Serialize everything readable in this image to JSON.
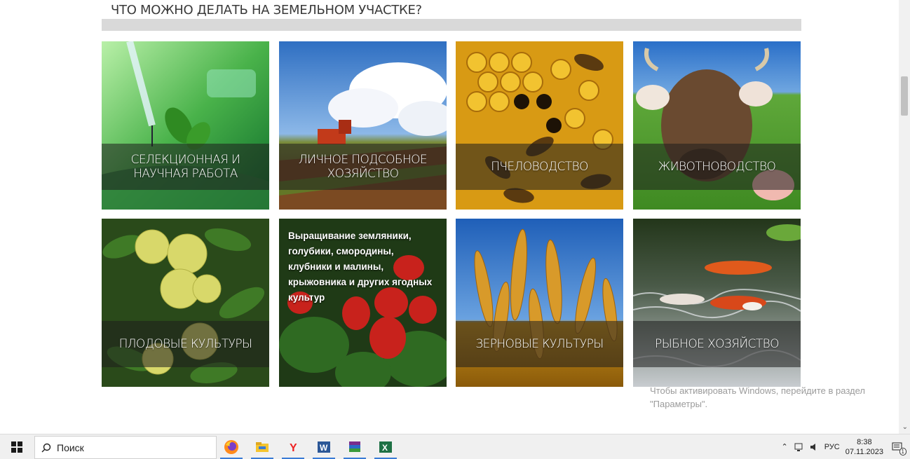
{
  "page": {
    "title": "ЧТО МОЖНО ДЕЛАТЬ НА ЗЕМЕЛЬНОМ УЧАСТКЕ?"
  },
  "tiles": [
    {
      "label": "СЕЛЕКЦИОННАЯ И НАУЧНАЯ РАБОТА"
    },
    {
      "label": "ЛИЧНОЕ ПОДСОБНОЕ ХОЗЯЙСТВО"
    },
    {
      "label": "ПЧЕЛОВОДСТВО"
    },
    {
      "label": "ЖИВОТНОВОДСТВО"
    },
    {
      "label": "ПЛОДОВЫЕ КУЛЬТУРЫ"
    },
    {
      "label": "",
      "overlay_text": "Выращивание земляники, голубики, смородины, клубники и малины, крыжовника и других ягодных культур"
    },
    {
      "label": "ЗЕРНОВЫЕ КУЛЬТУРЫ"
    },
    {
      "label": "РЫБНОЕ ХОЗЯЙСТВО"
    }
  ],
  "activation": {
    "line1": "Чтобы активировать Windows, перейдите в раздел",
    "line2": "\"Параметры\"."
  },
  "taskbar": {
    "search_placeholder": "Поиск",
    "apps": [
      {
        "icon": "firefox-icon"
      },
      {
        "icon": "file-explorer-icon"
      },
      {
        "icon": "yandex-browser-icon"
      },
      {
        "icon": "word-icon"
      },
      {
        "icon": "winrar-icon"
      },
      {
        "icon": "excel-icon"
      }
    ],
    "tray": {
      "language": "РУС",
      "time": "8:38",
      "date": "07.11.2023",
      "notification_count": "1"
    }
  },
  "colors": {
    "title_bar": "#d9d9d9",
    "band": "rgba(30,30,30,0.55)",
    "taskbar_accent": "#3a7bd5"
  }
}
